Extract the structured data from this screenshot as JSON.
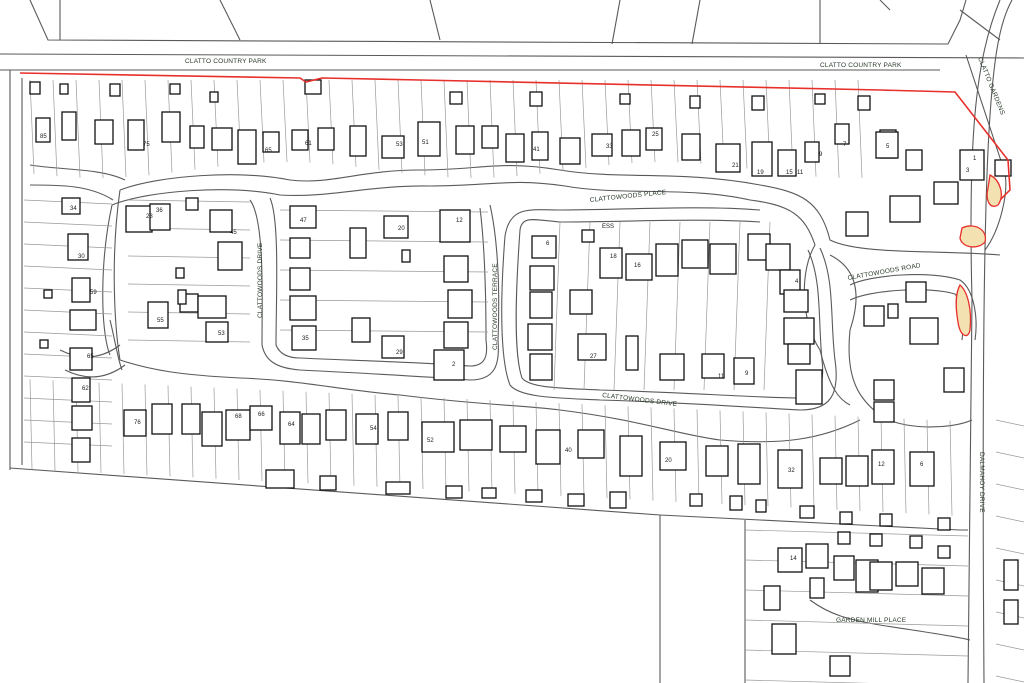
{
  "colors": {
    "site_boundary": "#e8302b",
    "site_patch": "#f3e1b2",
    "building_outline": "#111111",
    "road_outline": "#5a5a5a",
    "plot_line": "#9a9a9a"
  },
  "road_labels": {
    "clatto_country_park_west": "CLATTO COUNTRY PARK",
    "clatto_country_park_east": "CLATTO COUNTRY PARK",
    "clatto_gardens": "CLATTO GARDENS",
    "clattowoods_place": "CLATTOWOODS PLACE",
    "clattowoods_road": "CLATTOWOODS ROAD",
    "clattowoods_drive_west": "CLATTOWOODS DRIVE",
    "clattowoods_terrace": "CLATTOWOODS TERRACE",
    "clattowoods_drive_south": "CLATTOWOODS DRIVE",
    "dalmahoy_drive": "DALMAHOY DRIVE",
    "garden_mill_place": "GARDEN MILL PLACE"
  },
  "labels": {
    "ess": "ESS",
    "n85": "85",
    "n75": "75",
    "n65": "65",
    "n61": "61",
    "n53": "53",
    "n51": "51",
    "n41": "41",
    "n33": "33",
    "n25": "25",
    "n21": "21",
    "n19": "19",
    "n15": "15",
    "n11": "11",
    "n9": "9",
    "n7": "7",
    "n5": "5",
    "n1": "1",
    "n3": "3",
    "n34": "34",
    "n28": "28",
    "n36": "36",
    "n45": "45",
    "n47": "47",
    "n20": "20",
    "n12": "12",
    "n30": "30",
    "n59": "59",
    "n55": "55",
    "n53b": "53",
    "n65b": "65",
    "n35": "35",
    "n29": "29",
    "n2": "2",
    "n6": "6",
    "n18": "18",
    "n16": "16",
    "n27": "27",
    "n4": "4",
    "n62": "62",
    "n76": "76",
    "n68": "68",
    "n66": "66",
    "n64": "64",
    "n54": "54",
    "n52": "52",
    "n40": "40",
    "n20b": "20",
    "n32": "32",
    "n12b": "12",
    "n6b": "6",
    "n14": "14",
    "n9b": "9",
    "n11b": "11"
  }
}
